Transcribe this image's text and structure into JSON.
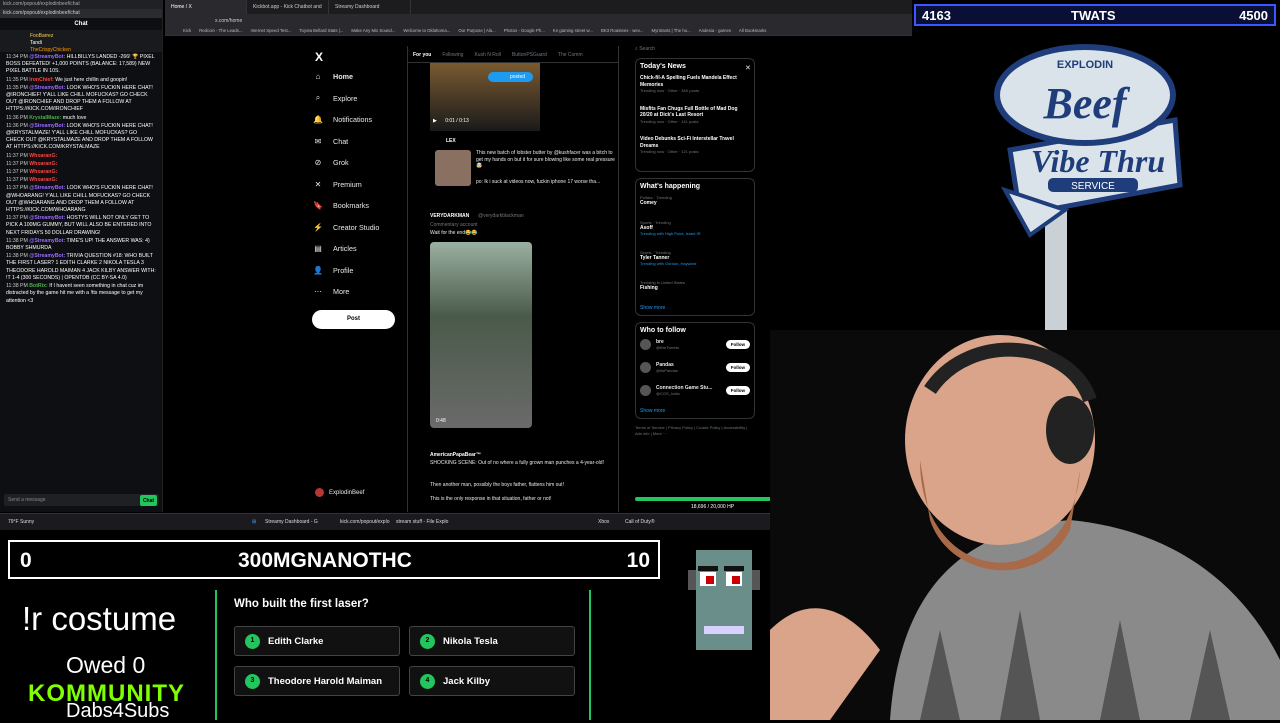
{
  "chat": {
    "url": "kick.com/popout/explodinbeef/chat",
    "url2": "kick.com/popout/explodinbeef/chat",
    "header": "Chat",
    "pinned": [
      "FooBarrez",
      "Tandi",
      "TheCrispyChicken"
    ],
    "messages": [
      {
        "time": "11:34 PM",
        "user": "@StreamyBot:",
        "text": "HILLBILLYS LANDED -266! 🏆 PIXEL BOSS DEFEATED! +1,000 POINTS (BALANCE: 17,589) NEW PIXEL BATTLE IN 10S.",
        "cls": "bot"
      },
      {
        "time": "11:35 PM",
        "user": "IronChief:",
        "text": "We just here chillin and goopin!",
        "cls": "u2"
      },
      {
        "time": "11:35 PM",
        "user": "@StreamyBot:",
        "text": "LOOK WHO'S FUCKIN HERE CHAT! @IRONCHIEF! Y'ALL LIKE CHILL MOFUCKAS? GO CHECK OUT @IRONCHIEF AND DROP THEM A FOLLOW AT HTTPS://KICK.COM/IRONCHIEF",
        "cls": "bot"
      },
      {
        "time": "11:36 PM",
        "user": "KrystalMaze:",
        "text": "much love",
        "cls": "u3"
      },
      {
        "time": "11:36 PM",
        "user": "@StreamyBot:",
        "text": "LOOK WHO'S FUCKIN HERE CHAT! @KRYSTALMAZE! Y'ALL LIKE CHILL MOFUCKAS? GO CHECK OUT @KRYSTALMAZE AND DROP THEM A FOLLOW AT HTTPS://KICK.COM/KRYSTALMAZE",
        "cls": "bot"
      },
      {
        "time": "11:37 PM",
        "user": "WhoaranG:",
        "text": "",
        "cls": "u2"
      },
      {
        "time": "11:37 PM",
        "user": "WhoaranG:",
        "text": "",
        "cls": "u2"
      },
      {
        "time": "11:37 PM",
        "user": "WhoaranG:",
        "text": "",
        "cls": "u2"
      },
      {
        "time": "11:37 PM",
        "user": "WhoaranG:",
        "text": "",
        "cls": "u2"
      },
      {
        "time": "11:37 PM",
        "user": "@StreamyBot:",
        "text": "LOOK WHO'S FUCKIN HERE CHAT! @WHOARANG! Y'ALL LIKE CHILL MOFUCKAS? GO CHECK OUT @WHOARANG AND DROP THEM A FOLLOW AT HTTPS://KICK.COM/WHOARANG",
        "cls": "bot"
      },
      {
        "time": "11:37 PM",
        "user": "@StreamyBot:",
        "text": "HOSTYS WILL NOT ONLY GET TO PICK A 100MG GUMMY, BUT WILL ALSO BE ENTERED INTO NEXT FRIDAYS 50 DOLLAR DRAWING!",
        "cls": "bot"
      },
      {
        "time": "11:38 PM",
        "user": "@StreamyBot:",
        "text": "TIME'S UP! THE ANSWER WAS: 4) BOBBY SHMURDA",
        "cls": "bot"
      },
      {
        "time": "11:38 PM",
        "user": "@StreamyBot:",
        "text": "TRIVIA QUESTION #18: WHO BUILT THE FIRST LASER? 1 EDITH CLARKE 2 NIKOLA TESLA 3 THEODORE HAROLD MAIMAN 4 JACK KILBY ANSWER WITH: !T 1-4 (300 SECONDS) | OPENTDB (CC BY-SA 4.0)",
        "cls": "bot"
      },
      {
        "time": "11:38 PM",
        "user": "BotRix:",
        "text": "If I havent seen something in chat cuz im distracted by the game hit me with a !tts message to get my attention <3",
        "cls": "u3"
      }
    ],
    "input_placeholder": "Send a message",
    "send_label": "Chat"
  },
  "browser": {
    "tabs": [
      "Home / X",
      "Kickbot.app - Kick Chatbot and",
      "Streamy Dashboard"
    ],
    "address": "x.com/home",
    "bookmarks": [
      "Kick",
      "Redcoin - The Leads...",
      "Internet Speed Test...",
      "Toyota Bellard Stats |...",
      "Make Any Mix Sound...",
      "Welcome to Oklahoma...",
      "Our Purpose | Ala...",
      "Photos - Google Ph...",
      "Kn gaming street w...",
      "BK3 Roastees - wex...",
      "Myntrants | The ho...",
      "Andesia - games",
      "All Bookmarks"
    ]
  },
  "x": {
    "logo": "X",
    "nav": [
      {
        "icon": "⌂",
        "label": "Home"
      },
      {
        "icon": "⌕",
        "label": "Explore"
      },
      {
        "icon": "🔔",
        "label": "Notifications"
      },
      {
        "icon": "✉",
        "label": "Chat"
      },
      {
        "icon": "⊘",
        "label": "Grok"
      },
      {
        "icon": "✕",
        "label": "Premium"
      },
      {
        "icon": "🔖",
        "label": "Bookmarks"
      },
      {
        "icon": "⚡",
        "label": "Creator Studio"
      },
      {
        "icon": "▤",
        "label": "Articles"
      },
      {
        "icon": "👤",
        "label": "Profile"
      },
      {
        "icon": "⋯",
        "label": "More"
      }
    ],
    "post_label": "Post",
    "profile_name": "ExplodinBeef",
    "feed_tabs": [
      "For you",
      "Following",
      "Kush N Roll",
      "ButtonPSGuard",
      "The Comm"
    ],
    "posted_label": "posted",
    "video_time1": "0:01 / 0:13",
    "tweet1": {
      "name": "LEX",
      "text": "This new batch of lobster butter by @kushfacer was a bitch to get my hands on but it for sure blowing like some real pressure 🤯",
      "sub": "po: lk i suck at videos now, fuckin iphone 17 worse tha..."
    },
    "tweet2": {
      "name": "VERYDARKMAN",
      "handle": "@verydarkblackman",
      "sub": "Commentary account",
      "text": "Wait for the end😂😂",
      "duration": "0:48"
    },
    "tweet3": {
      "name": "AmericanPapaBear™",
      "text": "SHOCKING SCENE: Out of no where a fully grown man punches a 4-year-old!",
      "text2": "Then another man, possibly the boys father, flattens him out!",
      "text3": "This is the only response in that situation, father or not!"
    }
  },
  "sidebar": {
    "search_placeholder": "Search",
    "news_title": "Today's News",
    "news": [
      {
        "title": "Chick-fil-A Spelling Fuels Mandela Effect Memories",
        "meta": "Trending now · Other · 34K posts"
      },
      {
        "title": "Misfits Fan Chugs Full Bottle of Mad Dog 20/20 at Dick's Last Resort",
        "meta": "Trending now · Other · 141 posts"
      },
      {
        "title": "Video Debunks Sci-Fi Interstellar Travel Dreams",
        "meta": "Trending now · Other · 121 posts"
      }
    ],
    "happening_title": "What's happening",
    "trends": [
      {
        "cat": "Politics · Trending",
        "name": "Comey",
        "extra": ""
      },
      {
        "cat": "Sports · Trending",
        "name": "Asoff",
        "extra": "Trending with High Point, Israel IR"
      },
      {
        "cat": "Sports · Trending",
        "name": "Tyler Tanner",
        "extra": "Trending with Gordon, Hayward"
      },
      {
        "cat": "Trending in United States",
        "name": "Fishing",
        "extra": ""
      }
    ],
    "show_more": "Show more",
    "follow_title": "Who to follow",
    "follows": [
      {
        "name": "bre",
        "handle": "@BreTweets",
        "btn": "Follow"
      },
      {
        "name": "Pandas",
        "handle": "@ItsPandas",
        "btn": "Follow"
      },
      {
        "name": "Connection Game Stu...",
        "handle": "@CGS_India",
        "btn": "Follow"
      }
    ],
    "footer": "Terms of Service | Privacy Policy | Cookie Policy | Accessibility | Ads info | More ···"
  },
  "hp": {
    "label": "18,696 / 20,000 HP",
    "fraction": 0.935
  },
  "taskbar": {
    "weather": "79°F Sunny",
    "apps": [
      "Streamy Dashboard - G",
      "kick.com/popout/explo",
      "stream stuff - File Explo",
      "Xbox",
      "Call of Duty®"
    ],
    "time": "10:52 PM",
    "date": "9/25/2025"
  },
  "overlay": {
    "score_left": "4163",
    "score_title": "TWATS",
    "score_right": "4500",
    "logo_top": "EXPLODIN",
    "logo_main": "Beef",
    "logo_sub": "Vibe Thru",
    "logo_service": "SERVICE",
    "bar_left": "0",
    "bar_title": "300MGNANOTHC",
    "bar_right": "10",
    "command": "!r costume",
    "owed": "Owed 0",
    "kommunity": "KOMMUNITY",
    "dabs": "Dabs4Subs",
    "trivia_question": "Who built the first laser?",
    "answers": [
      {
        "n": "1",
        "text": "Edith Clarke"
      },
      {
        "n": "2",
        "text": "Nikola Tesla"
      },
      {
        "n": "3",
        "text": "Theodore Harold Maiman"
      },
      {
        "n": "4",
        "text": "Jack Kilby"
      }
    ]
  }
}
